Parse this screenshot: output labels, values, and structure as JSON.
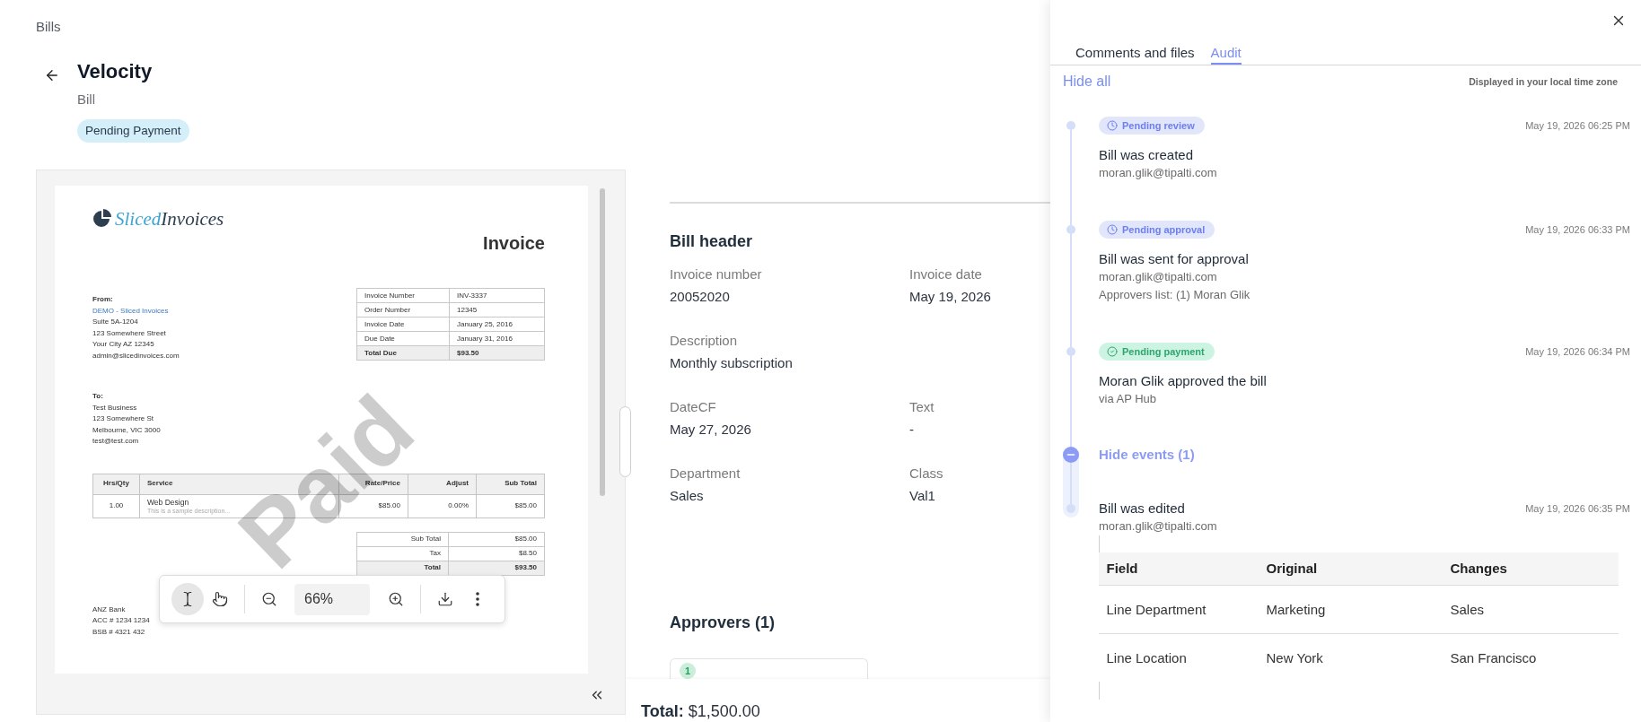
{
  "breadcrumb": "Bills",
  "header": {
    "title": "Velocity",
    "subtitle": "Bill",
    "status": "Pending Payment"
  },
  "document": {
    "invoice": {
      "logo": {
        "first": "Sliced",
        "second": "Invoices"
      },
      "title": "Invoice",
      "from": {
        "label": "From:",
        "name": "DEMO - Sliced Invoices",
        "lines": [
          "Suite 5A-1204",
          "123 Somewhere Street",
          "Your City AZ 12345",
          "admin@slicedinvoices.com"
        ]
      },
      "details": {
        "rows": [
          {
            "label": "Invoice Number",
            "value": "INV-3337"
          },
          {
            "label": "Order Number",
            "value": "12345"
          },
          {
            "label": "Invoice Date",
            "value": "January 25, 2016"
          },
          {
            "label": "Due Date",
            "value": "January 31, 2016"
          }
        ],
        "total": {
          "label": "Total Due",
          "value": "$93.50"
        }
      },
      "to": {
        "label": "To:",
        "lines": [
          "Test Business",
          "123 Somewhere St",
          "Melbourne, VIC 3000",
          "test@test.com"
        ]
      },
      "items": {
        "columns": [
          "Hrs/Qty",
          "Service",
          "Rate/Price",
          "Adjust",
          "Sub Total"
        ],
        "rows": [
          {
            "quantity": "1.00",
            "service": "Web Design",
            "description": "This is a sample description...",
            "rate": "$85.00",
            "adjust": "0.00%",
            "subtotal": "$85.00"
          }
        ]
      },
      "totals": {
        "rows": [
          {
            "label": "Sub Total",
            "value": "$85.00"
          },
          {
            "label": "Tax",
            "value": "$8.50"
          }
        ],
        "total": {
          "label": "Total",
          "value": "$93.50"
        }
      },
      "bank": [
        "ANZ Bank",
        "ACC # 1234 1234",
        "BSB # 4321 432"
      ],
      "stamp": "Paid"
    },
    "toolbar": {
      "tools": [
        {
          "kind": "text-select",
          "selected": true
        },
        {
          "kind": "hand",
          "selected": false
        }
      ],
      "zoom": "66%"
    }
  },
  "bill_header": {
    "title": "Bill header",
    "rows": [
      {
        "fields": [
          {
            "label": "Invoice number",
            "value": "20052020"
          },
          {
            "label": "Invoice date",
            "value": "May 19, 2026"
          }
        ]
      },
      {
        "fields": [
          {
            "label": "Description",
            "value": "Monthly subscription"
          }
        ]
      },
      {
        "fields": [
          {
            "label": "DateCF",
            "value": "May 27, 2026"
          },
          {
            "label": "Text",
            "value": "-"
          }
        ]
      },
      {
        "fields": [
          {
            "label": "Department",
            "value": "Sales"
          },
          {
            "label": "Class",
            "value": "Val1"
          }
        ]
      }
    ]
  },
  "approvers": {
    "title": "Approvers (1)",
    "cards": [
      {
        "number": "1"
      }
    ]
  },
  "footer": {
    "label": "Total:",
    "value": "$1,500.00"
  },
  "side_panel": {
    "tabs": [
      {
        "label": "Comments and files",
        "selected": false
      },
      {
        "label": "Audit",
        "selected": true
      }
    ],
    "hide_all": "Hide all",
    "time_zone_note": "Displayed in your local time zone",
    "timeline": [
      {
        "kind": "event",
        "badge": {
          "label": "Pending review",
          "kind": "pending"
        },
        "time": "May 19, 2026 06:25 PM",
        "title": "Bill was created",
        "details": [
          "moran.glik@tipalti.com"
        ]
      },
      {
        "kind": "event",
        "badge": {
          "label": "Pending approval",
          "kind": "pending"
        },
        "time": "May 19, 2026 06:33 PM",
        "title": "Bill was sent for approval",
        "details": [
          "moran.glik@tipalti.com",
          "Approvers list: (1) Moran Glik"
        ]
      },
      {
        "kind": "event",
        "badge": {
          "label": "Pending payment",
          "kind": "done"
        },
        "time": "May 19, 2026 06:34 PM",
        "title": "Moran Glik approved the bill",
        "details": [
          "via AP Hub"
        ]
      },
      {
        "kind": "group",
        "toggle": "Hide events (1)",
        "expanded": true,
        "events": [
          {
            "time": "May 19, 2026 06:35 PM",
            "title": "Bill was edited",
            "details": [
              "moran.glik@tipalti.com"
            ],
            "changes": {
              "columns": [
                "Field",
                "Original",
                "Changes"
              ],
              "rows": [
                [
                  "Line Department",
                  "Marketing",
                  "Sales"
                ],
                [
                  "Line Location",
                  "New York",
                  "San Francisco"
                ]
              ]
            }
          }
        ]
      }
    ]
  }
}
